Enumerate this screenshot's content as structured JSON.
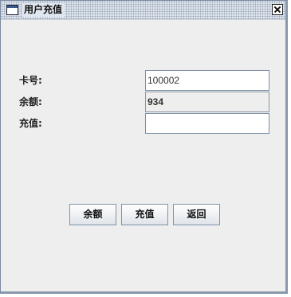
{
  "window": {
    "title": "用户充值"
  },
  "form": {
    "card_label": "卡号:",
    "card_value": "100002",
    "balance_label": "余额:",
    "balance_value": "934",
    "recharge_label": "充值:",
    "recharge_value": ""
  },
  "buttons": {
    "balance": "余额",
    "recharge": "充值",
    "back": "返回"
  }
}
